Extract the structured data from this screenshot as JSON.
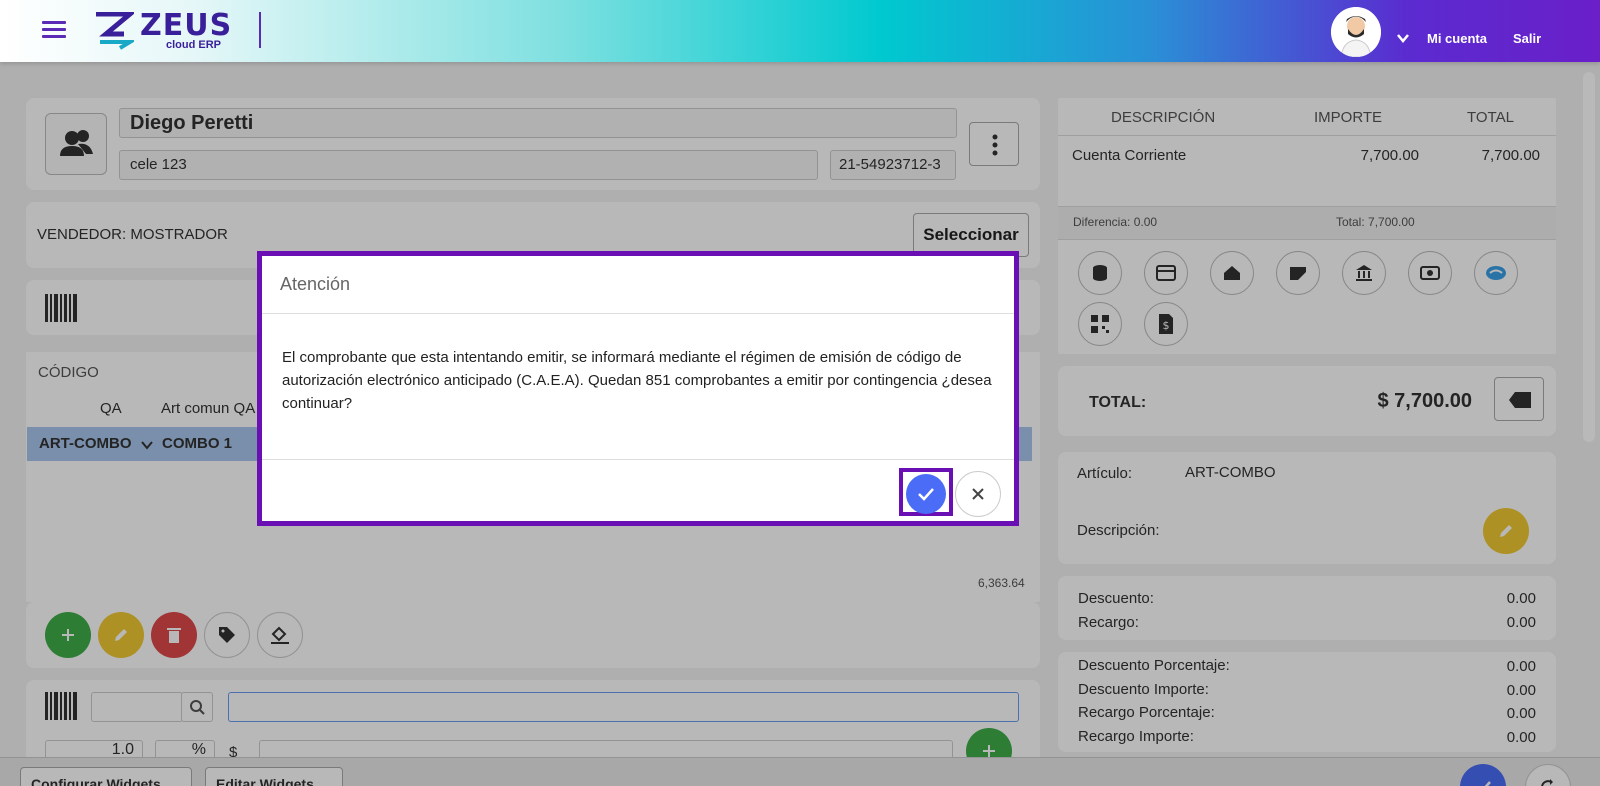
{
  "header": {
    "logo_name": "ZEUS",
    "logo_sub": "cloud ERP",
    "account_label": "Mi cuenta",
    "logout_label": "Salir"
  },
  "client": {
    "name": "Diego Peretti",
    "address": "cele 123",
    "cuit": "21-54923712-3"
  },
  "seller": {
    "label": "VENDEDOR: MOSTRADOR",
    "select_label": "Seleccionar"
  },
  "items_table": {
    "col_code": "CÓDIGO",
    "row_qa": "QA",
    "row_desc": "Art comun QA",
    "selected_code": "ART-COMBO",
    "selected_desc": "COMBO 1",
    "footer_value": "6,363.64"
  },
  "quick_add": {
    "qty": "1.0",
    "pct": "%",
    "currency": "$"
  },
  "bottom_bar": {
    "configure_label": "Configurar Widgets",
    "edit_label": "Editar Widgets"
  },
  "payments": {
    "col_desc": "DESCRIPCIÓN",
    "col_amount": "IMPORTE",
    "col_total": "TOTAL",
    "rows": [
      {
        "desc": "Cuenta Corriente",
        "amount": "7,700.00",
        "total": "7,700.00"
      }
    ],
    "diff_label": "Diferencia: 0.00",
    "total_label": "Total: 7,700.00"
  },
  "totals": {
    "label": "TOTAL:",
    "value": "$ 7,700.00"
  },
  "article": {
    "label": "Artículo:",
    "value": "ART-COMBO",
    "desc_label": "Descripción:"
  },
  "adjustments": {
    "discount_label": "Descuento:",
    "discount_value": "0.00",
    "surcharge_label": "Recargo:",
    "surcharge_value": "0.00",
    "disc_pct_label": "Descuento Porcentaje:",
    "disc_pct_value": "0.00",
    "disc_amt_label": "Descuento Importe:",
    "disc_amt_value": "0.00",
    "sur_pct_label": "Recargo Porcentaje:",
    "sur_pct_value": "0.00",
    "sur_amt_label": "Recargo Importe:",
    "sur_amt_value": "0.00"
  },
  "modal": {
    "title": "Atención",
    "message": "El comprobante que esta intentando emitir, se informará mediante el régimen de emisión de código de autorización electrónico anticipado (C.A.E.A). Quedan 851 comprobantes a emitir por contingencia ¿desea continuar?"
  },
  "colors": {
    "accent_purple": "#6a0fb3",
    "confirm_blue": "#4a6cf7",
    "add_green": "#3fae49",
    "edit_yellow": "#f2c933",
    "delete_red": "#e04848"
  }
}
